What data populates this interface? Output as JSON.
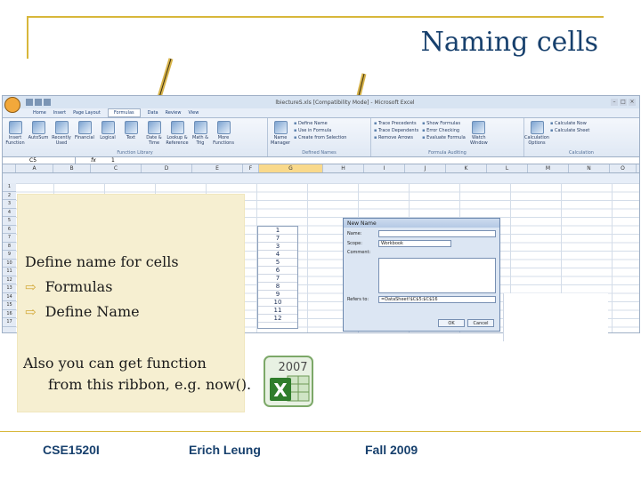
{
  "slide": {
    "title": "Naming cells",
    "footer": {
      "course": "CSE1520I",
      "author": "Erich Leung",
      "term": "Fall 2009"
    },
    "note": {
      "heading": "Define name for cells",
      "bullet_1": "Formulas",
      "bullet_2": "Define Name",
      "extra_1": "Also you can get function",
      "extra_2": "from this ribbon, e.g. now()."
    },
    "logo_year": "2007"
  },
  "excel": {
    "window_title": "lbiectureS.xls [Compatibility Mode] - Microsoft Excel",
    "tabs": [
      "Home",
      "Insert",
      "Page Layout",
      "Formulas",
      "Data",
      "Review",
      "View"
    ],
    "active_tab": "Formulas",
    "ribbon": {
      "groups": [
        {
          "label": "Function Library",
          "buttons": [
            "Insert Function",
            "AutoSum",
            "Recently Used",
            "Financial",
            "Logical",
            "Text",
            "Date & Time",
            "Lookup & Reference",
            "Math & Trig",
            "More Functions"
          ]
        },
        {
          "label": "Defined Names",
          "buttons": [
            "Name Manager"
          ],
          "small": [
            "Define Name",
            "Use in Formula",
            "Create from Selection"
          ]
        },
        {
          "label": "Formula Auditing",
          "small": [
            "Trace Precedents",
            "Trace Dependents",
            "Remove Arrows",
            "Show Formulas",
            "Error Checking",
            "Evaluate Formula"
          ],
          "buttons": [
            "Watch Window"
          ]
        },
        {
          "label": "Calculation",
          "buttons": [
            "Calculation Options"
          ],
          "small": [
            "Calculate Now",
            "Calculate Sheet"
          ]
        }
      ]
    },
    "namebox": "C5",
    "formula_value": "1",
    "columns": [
      "A",
      "B",
      "C",
      "D",
      "E",
      "F",
      "G",
      "H",
      "I",
      "J",
      "K",
      "L",
      "M",
      "N",
      "O"
    ],
    "selected_column": "G",
    "column_values": [
      "1",
      "7",
      "3",
      "4",
      "5",
      "6",
      "7",
      "8",
      "9",
      "10",
      "11",
      "12"
    ],
    "dialog": {
      "title": "New Name",
      "name_label": "Name:",
      "name_value": "",
      "scope_label": "Scope:",
      "scope_value": "Workbook",
      "comment_label": "Comment:",
      "refers_label": "Refers to:",
      "refers_value": "=DataSheet!$C$5:$C$16",
      "ok_label": "OK",
      "cancel_label": "Cancel"
    }
  },
  "colors": {
    "accent_gold": "#d8b73a",
    "title_blue": "#17406d",
    "note_bg": "#f6efd1"
  }
}
